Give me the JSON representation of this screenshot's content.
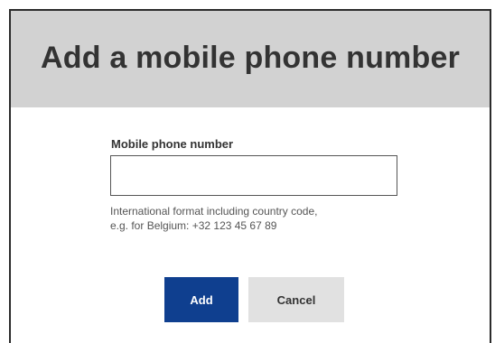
{
  "dialog": {
    "title": "Add a mobile phone number",
    "field_label": "Mobile phone number",
    "phone_value": "",
    "hint_line1": "International format including country code,",
    "hint_line2": "e.g. for Belgium: +32 123 45 67 89",
    "add_label": "Add",
    "cancel_label": "Cancel"
  },
  "colors": {
    "header_bg": "#d2d2d2",
    "primary_button": "#0f3f8f",
    "secondary_button": "#e1e1e1"
  }
}
